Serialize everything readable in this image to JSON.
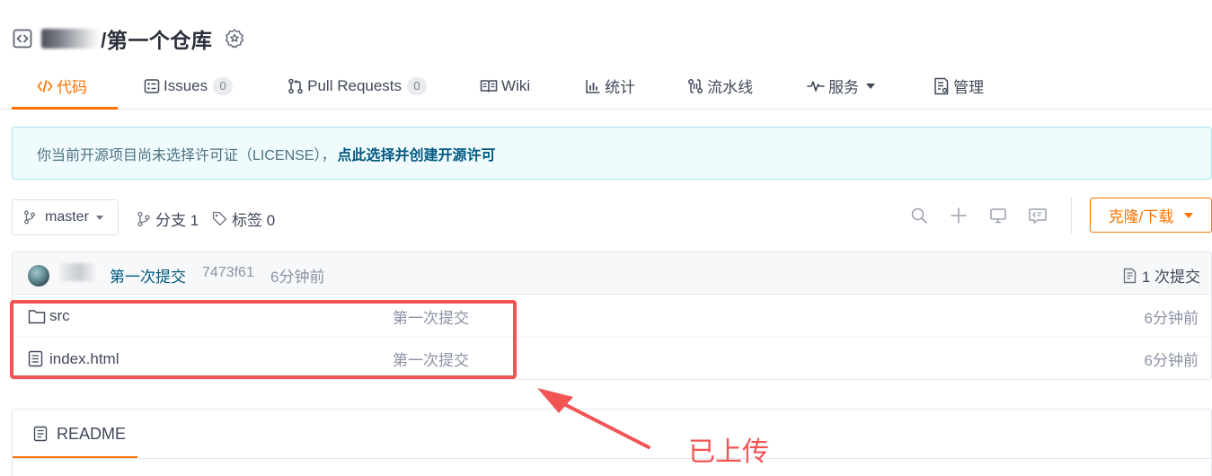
{
  "repo": {
    "owner": "",
    "name": "/第一个仓库"
  },
  "tabs": [
    {
      "label": "代码",
      "icon": "code-icon",
      "active": true
    },
    {
      "label": "Issues",
      "count": "0",
      "icon": "issues-icon"
    },
    {
      "label": "Pull Requests",
      "count": "0",
      "icon": "pull-request-icon"
    },
    {
      "label": "Wiki",
      "icon": "book-icon"
    },
    {
      "label": "统计",
      "icon": "bar-chart-icon"
    },
    {
      "label": "流水线",
      "icon": "pipeline-icon"
    },
    {
      "label": "服务",
      "icon": "pulse-icon",
      "has_dropdown": true
    },
    {
      "label": "管理",
      "icon": "settings-doc-icon"
    }
  ],
  "license_notice": {
    "text": "你当前开源项目尚未选择许可证（LICENSE），",
    "link": "点此选择并创建开源许可"
  },
  "branch": {
    "selected": "master",
    "branches_label": "分支 1",
    "tags_label": "标签 0"
  },
  "toolbar": {
    "icons": [
      "search-icon",
      "plus-icon",
      "monitor-icon",
      "comment-code-icon"
    ],
    "clone_label": "克隆/下载"
  },
  "latest_commit": {
    "author": "",
    "message": "第一次提交",
    "sha": "7473f61",
    "time": "6分钟前",
    "count_label": "1 次提交"
  },
  "files": [
    {
      "name": "src",
      "type": "folder",
      "commit": "第一次提交",
      "time": "6分钟前"
    },
    {
      "name": "index.html",
      "type": "file",
      "commit": "第一次提交",
      "time": "6分钟前"
    }
  ],
  "readme": {
    "tab_label": "README"
  },
  "annotation": {
    "text": "已上传"
  },
  "colors": {
    "accent": "#fe7300",
    "link": "#005980",
    "annotation": "#f25454",
    "notice_bg": "#f0fbfe"
  }
}
